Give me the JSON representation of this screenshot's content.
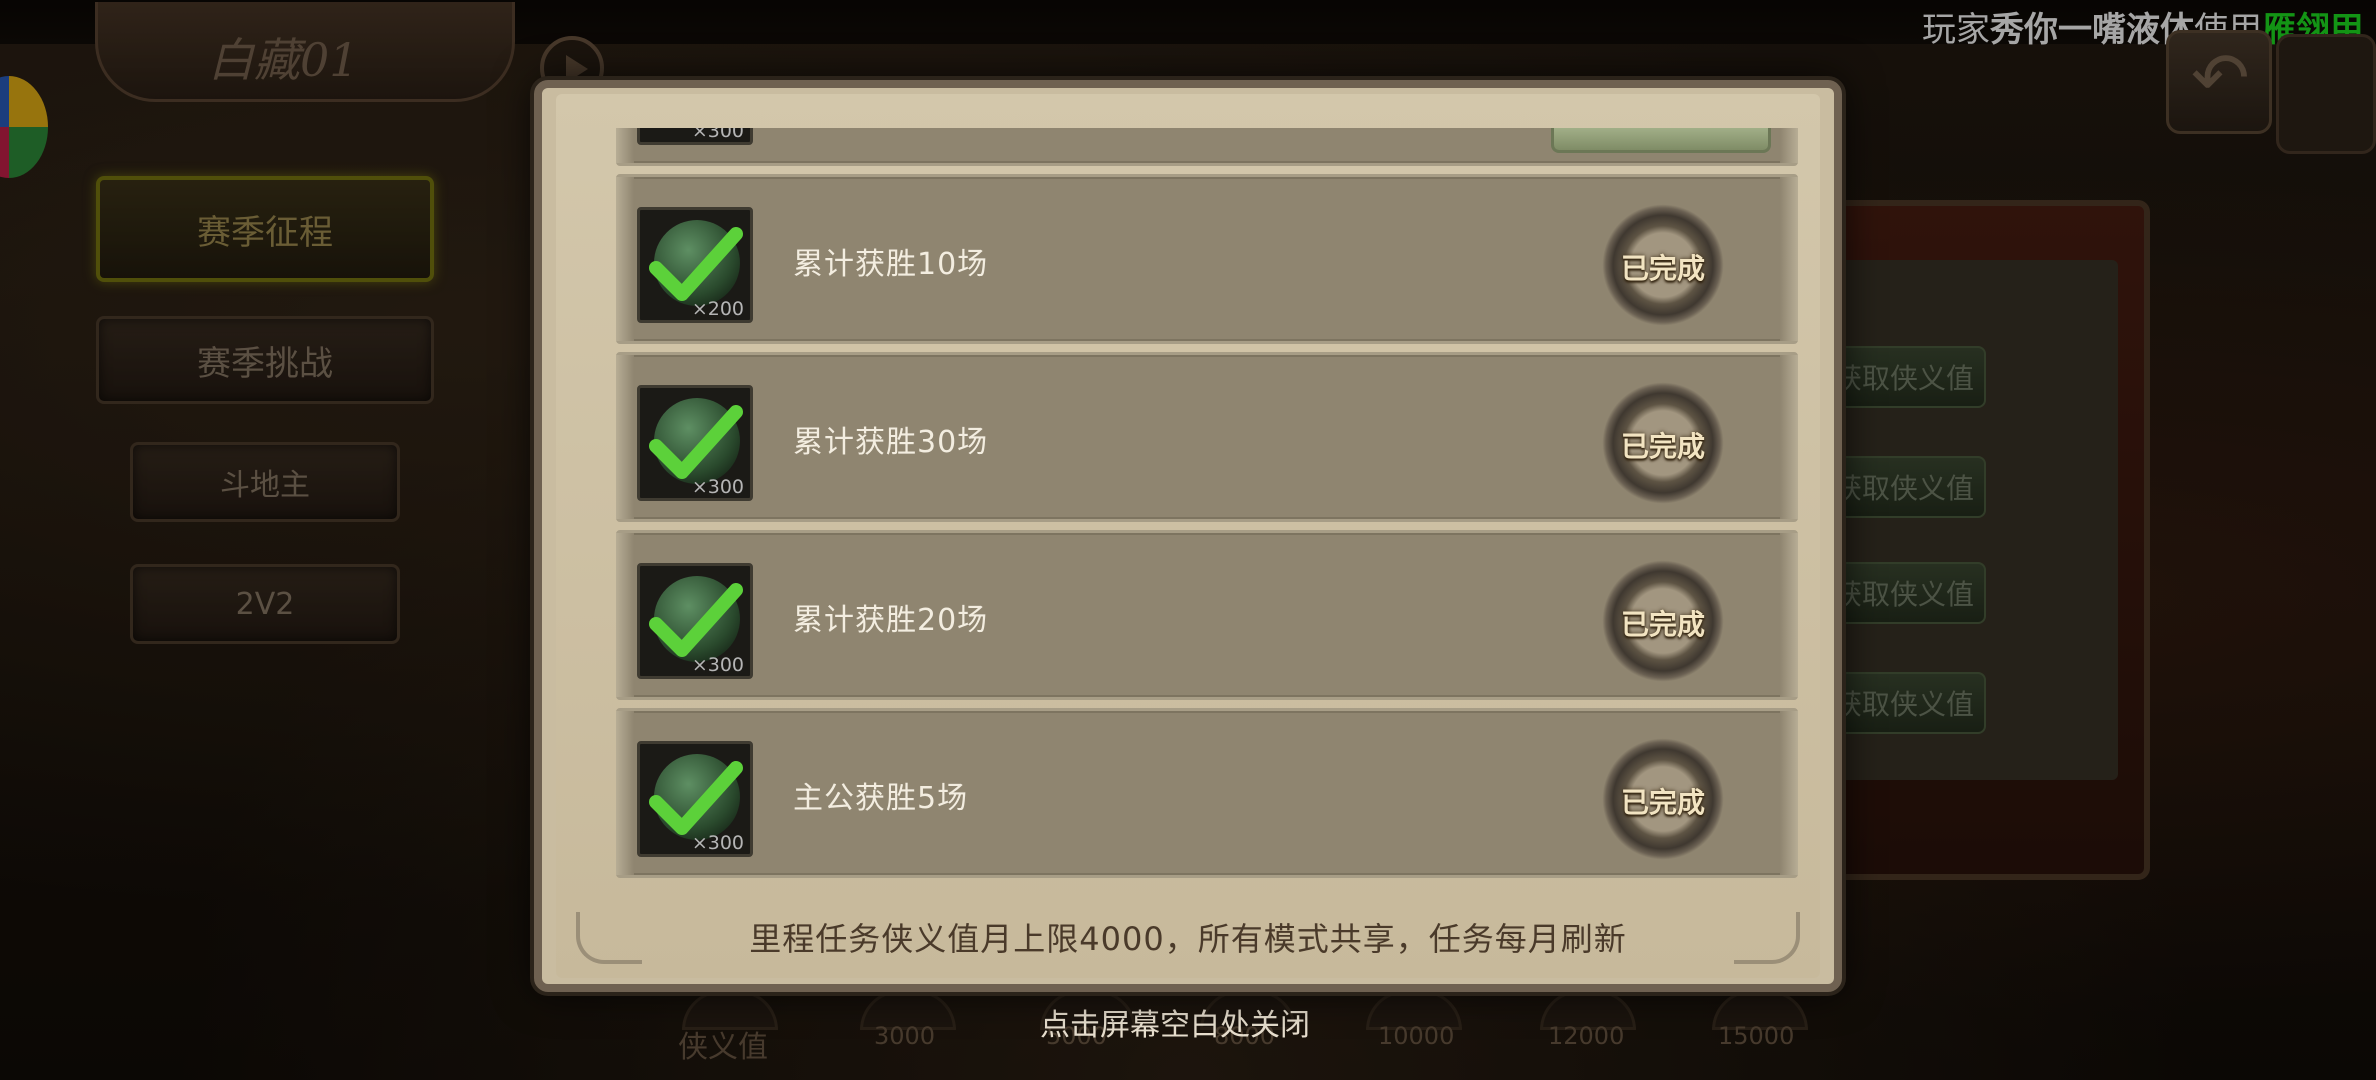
{
  "header": {
    "season_title": "白藏01",
    "marquee": {
      "prefix": "玩家",
      "player": "秀你一嘴液体",
      "middle": "使用",
      "item": "雁翎甲"
    }
  },
  "side_menu": [
    {
      "label": "赛季征程",
      "active": true
    },
    {
      "label": "赛季挑战",
      "active": false
    },
    {
      "label": "斗地主",
      "active": false
    },
    {
      "label": "2V2",
      "active": false
    }
  ],
  "right_panel": {
    "buttons": [
      "获取侠义值",
      "获取侠义值",
      "获取侠义值",
      "获取侠义值"
    ]
  },
  "modal": {
    "tasks": [
      {
        "title": "",
        "reward_qty": "×300",
        "status": "",
        "partial": true
      },
      {
        "title": "累计获胜10场",
        "reward_qty": "×200",
        "status": "已完成"
      },
      {
        "title": "累计获胜30场",
        "reward_qty": "×300",
        "status": "已完成"
      },
      {
        "title": "累计获胜20场",
        "reward_qty": "×300",
        "status": "已完成"
      },
      {
        "title": "主公获胜5场",
        "reward_qty": "×300",
        "status": "已完成"
      }
    ],
    "footer_note": "里程任务侠义值月上限4000，所有模式共享，任务每月刷新"
  },
  "bottom_bar": {
    "label": "侠义值",
    "close_hint": "点击屏幕空白处关闭",
    "milestones": [
      "3000",
      "5000",
      "8000",
      "10000",
      "12000",
      "15000"
    ]
  },
  "colors": {
    "accent_green": "#1ee321",
    "badge_text": "#f2e4c2",
    "modal_bg": "#c9bca0",
    "row_bg": "#8f8570"
  }
}
